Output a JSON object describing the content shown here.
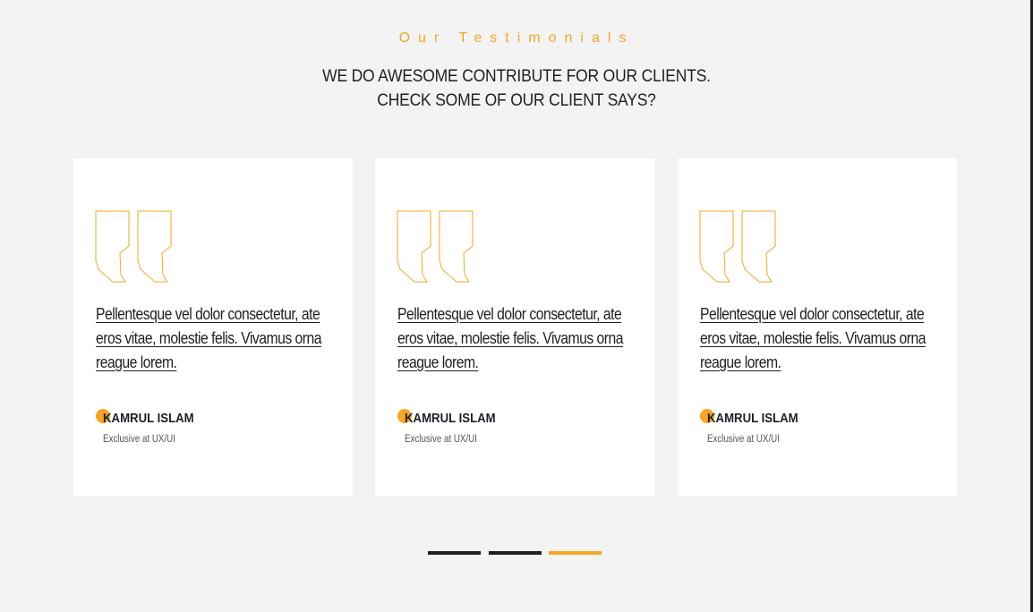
{
  "section": {
    "eyebrow": "Our Testimonials",
    "headline_line1": "WE DO AWESOME CONTRIBUTE FOR OUR CLIENTS.",
    "headline_line2": "CHECK SOME OF OUR CLIENT SAYS?"
  },
  "colors": {
    "accent": "#f5a623",
    "text_dark": "#1d1f24",
    "background": "#f3f3f3",
    "card": "#ffffff"
  },
  "testimonials": [
    {
      "icon": "quote-icon",
      "quote": "Pellentesque vel dolor consectetur, ate eros vitae, molestie felis. Vivamus orna reague lorem.",
      "name": "KAMRUL ISLAM",
      "role": "Exclusive at UX/UI"
    },
    {
      "icon": "quote-icon",
      "quote": "Pellentesque vel dolor consectetur, ate eros vitae, molestie felis. Vivamus orna reague lorem.",
      "name": "KAMRUL ISLAM",
      "role": "Exclusive at UX/UI"
    },
    {
      "icon": "quote-icon",
      "quote": "Pellentesque vel dolor consectetur, ate eros vitae, molestie felis. Vivamus orna reague lorem.",
      "name": "KAMRUL ISLAM",
      "role": "Exclusive at UX/UI"
    }
  ],
  "pagination": {
    "count": 3,
    "active_index": 2
  }
}
